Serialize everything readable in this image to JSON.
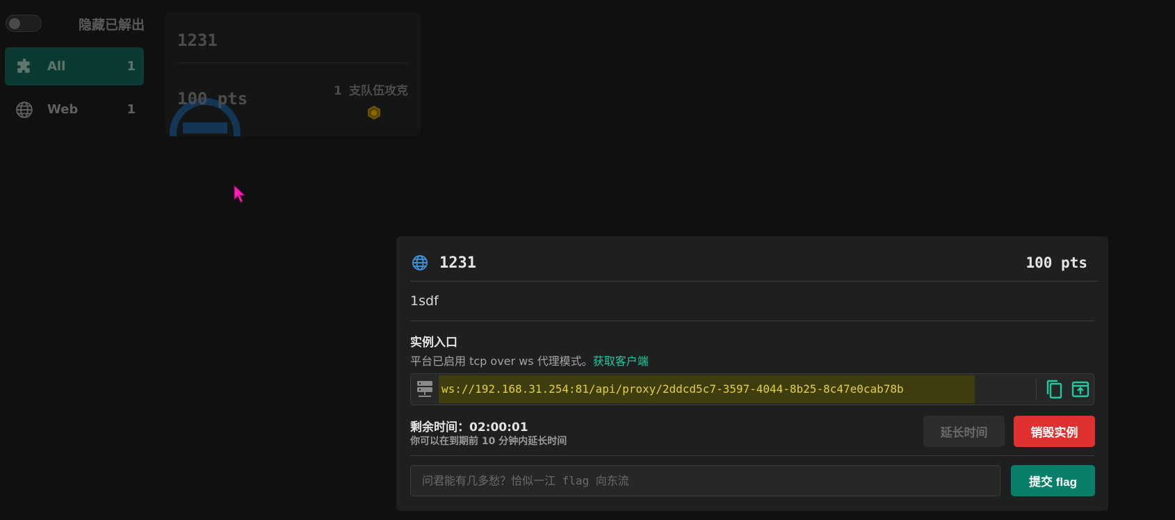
{
  "sidebar": {
    "toggle_label": "隐藏已解出",
    "categories": [
      {
        "label": "All",
        "count": "1",
        "icon": "puzzle-icon",
        "active": true
      },
      {
        "label": "Web",
        "count": "1",
        "icon": "globe-icon",
        "active": false
      }
    ]
  },
  "challenge_card": {
    "title": "1231",
    "points": "100 pts",
    "solved_count": "1",
    "solved_label": "支队伍攻克"
  },
  "modal": {
    "title": "1231",
    "points": "100 pts",
    "description": "1sdf",
    "instance": {
      "title": "实例入口",
      "subtitle": "平台已启用 tcp over ws 代理模式。",
      "client_link": "获取客户端",
      "url": "ws://192.168.31.254:81/api/proxy/2ddcd5c7-3597-4044-8b25-8c47e0cab78b"
    },
    "timer": {
      "label": "剩余时间：02:00:01",
      "hint": "你可以在到期前 10 分钟内延长时间"
    },
    "buttons": {
      "extend": "延长时间",
      "destroy": "销毁实例",
      "submit": "提交 flag"
    },
    "flag_input": {
      "placeholder": "问君能有几多愁？恰似一江 flag 向东流",
      "value": ""
    }
  },
  "colors": {
    "accent": "#20c9a0",
    "url_highlight_bg": "#3f3d0d",
    "url_text": "#e3d33a",
    "destroy": "#e03131",
    "submit": "#087f68",
    "globe": "#3b8ed8"
  }
}
